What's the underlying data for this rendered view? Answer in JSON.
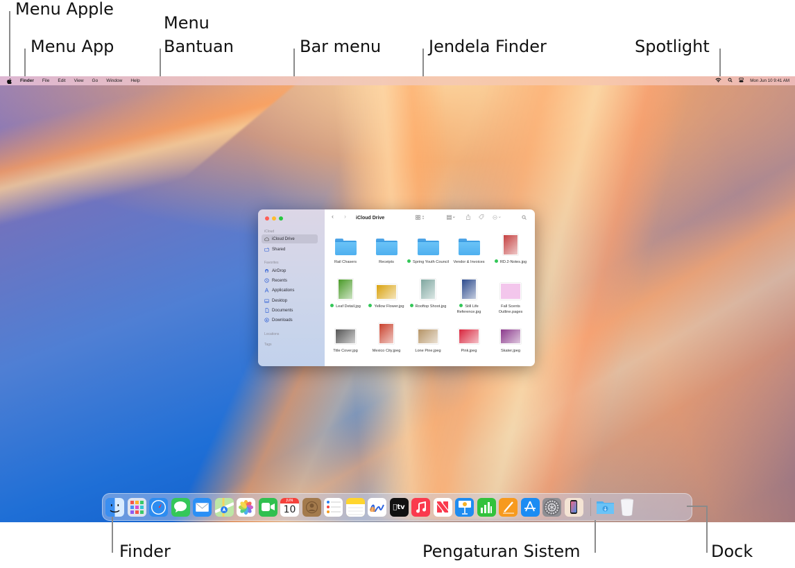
{
  "callouts": {
    "apple_menu": "Menu Apple",
    "app_menu": "Menu App",
    "help_menu": "Menu\nBantuan",
    "help_menu_line1": "Menu",
    "help_menu_line2": "Bantuan",
    "menu_bar": "Bar menu",
    "finder_window": "Jendela Finder",
    "spotlight": "Spotlight",
    "finder": "Finder",
    "system_settings": "Pengaturan Sistem",
    "dock": "Dock"
  },
  "menubar": {
    "apple_icon": "apple-logo",
    "app_name": "Finder",
    "items": [
      "File",
      "Edit",
      "View",
      "Go",
      "Window",
      "Help"
    ],
    "status_icons": [
      "wifi-icon",
      "spotlight-search-icon",
      "control-center-icon"
    ],
    "clock": "Mon Jun 10  9:41 AM"
  },
  "finder": {
    "title": "iCloud Drive",
    "traffic_colors": [
      "#ff5f57",
      "#febc2e",
      "#28c840"
    ],
    "sidebar": {
      "sections": [
        {
          "label": "iCloud",
          "items": [
            {
              "label": "iCloud Drive",
              "icon": "cloud-icon",
              "selected": true
            },
            {
              "label": "Shared",
              "icon": "shared-folder-icon"
            }
          ]
        },
        {
          "label": "Favorites",
          "items": [
            {
              "label": "AirDrop",
              "icon": "airdrop-icon"
            },
            {
              "label": "Recents",
              "icon": "clock-icon"
            },
            {
              "label": "Applications",
              "icon": "applications-icon"
            },
            {
              "label": "Desktop",
              "icon": "desktop-icon"
            },
            {
              "label": "Documents",
              "icon": "document-icon"
            },
            {
              "label": "Downloads",
              "icon": "download-icon"
            }
          ]
        },
        {
          "label": "Locations",
          "items": []
        },
        {
          "label": "Tags",
          "items": []
        }
      ]
    },
    "toolbar": [
      "back-icon",
      "forward-icon",
      "view-mode-icon",
      "group-icon",
      "share-icon",
      "tag-icon",
      "more-icon",
      "search-icon"
    ],
    "files": [
      {
        "name": "Rail Chasers",
        "type": "folder",
        "tag": false
      },
      {
        "name": "Receipts",
        "type": "folder",
        "tag": false
      },
      {
        "name": "Spring Youth Council",
        "type": "folder",
        "tag": true
      },
      {
        "name": "Vendor & Invoices",
        "type": "folder",
        "tag": false
      },
      {
        "name": "RD.2-Notes.jpg",
        "type": "image",
        "tag": true,
        "color": "#c44040"
      },
      {
        "name": "Leaf Detail.jpg",
        "type": "image",
        "tag": true,
        "color": "#4a9a28"
      },
      {
        "name": "Yellow Flower.jpg",
        "type": "image",
        "tag": true,
        "color": "#d9a20e"
      },
      {
        "name": "Rooftop Shoot.jpg",
        "type": "image",
        "tag": true,
        "color": "#7fa7a0"
      },
      {
        "name": "Still Life Reference.jpg",
        "type": "image",
        "tag": true,
        "color": "#2c4a8c"
      },
      {
        "name": "Fall Scents Outline.pages",
        "type": "pages",
        "tag": false,
        "color": "#f3c6ec"
      },
      {
        "name": "Title Cover.jpg",
        "type": "image",
        "tag": false,
        "color": "#555555"
      },
      {
        "name": "Mexico City.jpeg",
        "type": "image",
        "tag": false,
        "color": "#c9402c"
      },
      {
        "name": "Lone Pine.jpeg",
        "type": "image",
        "tag": false,
        "color": "#b59466"
      },
      {
        "name": "Pink.jpeg",
        "type": "image",
        "tag": false,
        "color": "#d8243c"
      },
      {
        "name": "Skater.jpeg",
        "type": "image",
        "tag": false,
        "color": "#8b3a8c"
      }
    ]
  },
  "dock": {
    "apps": [
      {
        "name": "Finder",
        "icon": "finder-icon",
        "bg": "#3a8ef0"
      },
      {
        "name": "Launchpad",
        "icon": "launchpad-icon",
        "bg": "#dfe4ef"
      },
      {
        "name": "Safari",
        "icon": "safari-icon",
        "bg": "#2d8cf0"
      },
      {
        "name": "Messages",
        "icon": "messages-icon",
        "bg": "#34c759"
      },
      {
        "name": "Mail",
        "icon": "mail-icon",
        "bg": "#2b8ff5"
      },
      {
        "name": "Maps",
        "icon": "maps-icon",
        "bg": "#8fd17e"
      },
      {
        "name": "Photos",
        "icon": "photos-icon",
        "bg": "#ffffff"
      },
      {
        "name": "FaceTime",
        "icon": "facetime-icon",
        "bg": "#30c04f"
      },
      {
        "name": "Calendar",
        "icon": "calendar-icon",
        "bg": "#ffffff",
        "month": "JUN",
        "day": "10"
      },
      {
        "name": "Contacts",
        "icon": "contacts-icon",
        "bg": "#a37a4c"
      },
      {
        "name": "Reminders",
        "icon": "reminders-icon",
        "bg": "#ffffff"
      },
      {
        "name": "Notes",
        "icon": "notes-icon",
        "bg": "#ffd52e"
      },
      {
        "name": "Freeform",
        "icon": "freeform-icon",
        "bg": "#ffffff"
      },
      {
        "name": "TV",
        "icon": "apple-tv-icon",
        "bg": "#111111",
        "label": "tv"
      },
      {
        "name": "Music",
        "icon": "music-icon",
        "bg": "#fa3a4d"
      },
      {
        "name": "News",
        "icon": "news-icon",
        "bg": "#ffffff"
      },
      {
        "name": "Keynote",
        "icon": "keynote-icon",
        "bg": "#1f8cf0"
      },
      {
        "name": "Numbers",
        "icon": "numbers-icon",
        "bg": "#32c23c"
      },
      {
        "name": "Pages",
        "icon": "pages-icon",
        "bg": "#f79a1e"
      },
      {
        "name": "App Store",
        "icon": "app-store-icon",
        "bg": "#1b8cf3"
      },
      {
        "name": "System Settings",
        "icon": "system-settings-icon",
        "bg": "#8e8e93"
      },
      {
        "name": "iPhone Mirroring",
        "icon": "iphone-mirroring-icon",
        "bg": "#f4e4d4"
      }
    ],
    "extras": [
      {
        "name": "Downloads",
        "icon": "downloads-folder-icon"
      },
      {
        "name": "Trash",
        "icon": "trash-icon"
      }
    ]
  }
}
